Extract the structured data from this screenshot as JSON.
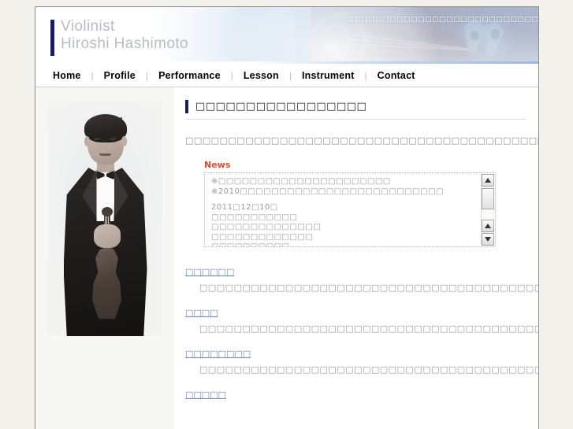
{
  "site": {
    "brand_line1": "Violinist",
    "brand_line2": "Hiroshi Hashimoto",
    "brand_block": "Violinist\nHiroshi Hashimoto",
    "accent_navy": "#1b1b6e",
    "accent_red": "#e8452b",
    "link_blue": "#7288bb",
    "body_gray": "#9a9a9a",
    "page_bg": "#f2f1ec",
    "sidebar_bg": "#f7f7f3"
  },
  "header": {
    "tagline": "□□□□□□□□□□□□□□□□□□□□□□□□□□□□□□□□□□□□□□□□□□□□□",
    "banner_image_name": "violin-scroll-and-bridge-photo"
  },
  "nav": {
    "items": [
      {
        "label": "Home"
      },
      {
        "label": "Profile"
      },
      {
        "label": "Performance"
      },
      {
        "label": "Lesson"
      },
      {
        "label": "Instrument"
      },
      {
        "label": "Contact"
      }
    ],
    "separator": "|"
  },
  "sidebar": {
    "portrait_alt": "violinist-portrait-black-and-white"
  },
  "main": {
    "heading": "□□□□□□□□□□□□□□□□□",
    "intro": "□□□□□□□□□□□□□□□□□□□□□□□□□□□□□□□□□□□□□□□□□□□□□□□□□□□□□□□□□□□□□□□□□□□□□□□□□□□□□□□□□□□□□□",
    "news": {
      "title": "News",
      "lines": [
        "※□□□□□□□□□□□□□□□□□□□□□□",
        "※2010□□□□□□□□□□□□□□□□□□□□□□□□□□",
        "",
        "2011□12□10□",
        "□□□□□□□□□□□",
        "□□□□□□□□□□□□□□",
        "□□□□□□□□□□□□□",
        "□□□□□□□□□□"
      ],
      "scrollbar": {
        "up_top_icon": "triangle-up-icon",
        "up_bottom_icon": "triangle-up-icon",
        "down_bottom_icon": "triangle-down-icon"
      }
    },
    "sections": [
      {
        "link": "□□□□□□",
        "body": "□□□□□□□□□□□□□□□□□□□□□□□□□□□□□□□□□□□□□□□□□□□□□□□□□□□□□□□□□□□□□□□□□□□□□□□□□□□□□□□□□□□□"
      },
      {
        "link": "□□□□",
        "body": "□□□□□□□□□□□□□□□□□□□□□□□□□□□□□□□□□□□□□□□□□□□□□□□□□□□□□□□□□□□□□□□□□□□□□□□□□□□□□□□□□□□□□□□□□□□□□□□□□"
      },
      {
        "link": "□□□□□□□□",
        "body": "□□□□□□□□□□□□□□□□□□□□□□□□□□□□□□□□□□□□□□□□□□□□□□□□□□□□□□□□□□□□□□□□□□□□□□□□□□□□□□□□□□□□□□□□□□□□□□□□□□□□□□□"
      },
      {
        "link": "□□□□□",
        "body": ""
      }
    ]
  }
}
